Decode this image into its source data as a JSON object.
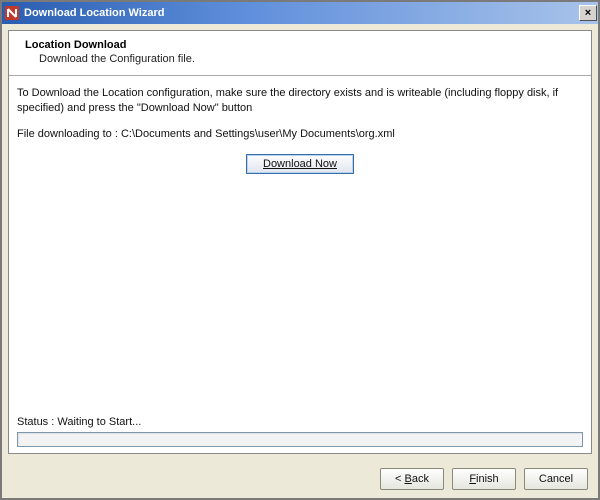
{
  "titlebar": {
    "title": "Download Location Wizard",
    "close": "×"
  },
  "header": {
    "title": "Location Download",
    "subtitle": "Download the Configuration file."
  },
  "body": {
    "instruction": "To Download the Location configuration, make sure the directory exists and is writeable (including floppy disk, if specified) and press the \"Download Now\" button",
    "path_prefix": "File downloading to : ",
    "path": "C:\\Documents and Settings\\user\\My Documents\\org.xml",
    "download_button": "Download Now",
    "status_prefix": "Status : ",
    "status": "Waiting to Start..."
  },
  "footer": {
    "back": "< Back",
    "finish": "Finish",
    "cancel": "Cancel"
  }
}
